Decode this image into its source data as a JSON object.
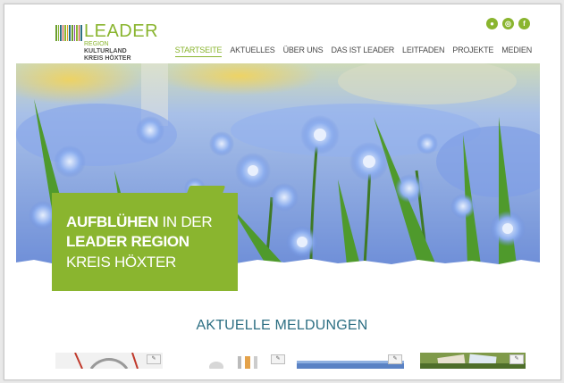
{
  "header": {
    "logo": {
      "word": "LEADER",
      "line1": "REGION",
      "line2": "KULTURLAND",
      "line3": "KREIS HÖXTER"
    },
    "social": [
      {
        "icon": "speech-bubble-icon",
        "glyph": "●"
      },
      {
        "icon": "search-icon",
        "glyph": "◎"
      },
      {
        "icon": "facebook-icon",
        "glyph": "f"
      }
    ],
    "nav": [
      {
        "label": "STARTSEITE",
        "active": true
      },
      {
        "label": "AKTUELLES",
        "active": false
      },
      {
        "label": "ÜBER UNS",
        "active": false
      },
      {
        "label": "DAS IST LEADER",
        "active": false
      },
      {
        "label": "LEITFADEN",
        "active": false
      },
      {
        "label": "PROJEKTE",
        "active": false
      },
      {
        "label": "MEDIEN",
        "active": false
      }
    ]
  },
  "hero": {
    "callout_line1_bold": "AUFBLÜHEN",
    "callout_line1_rest": " IN DER",
    "callout_line2": "LEADER REGION",
    "callout_line3": "KREIS HÖXTER"
  },
  "news": {
    "title": "AKTUELLE MELDUNGEN"
  },
  "colors": {
    "brand_green": "#8ab52f",
    "title_teal": "#2d6f83",
    "nav_text": "#4a4a4a"
  }
}
